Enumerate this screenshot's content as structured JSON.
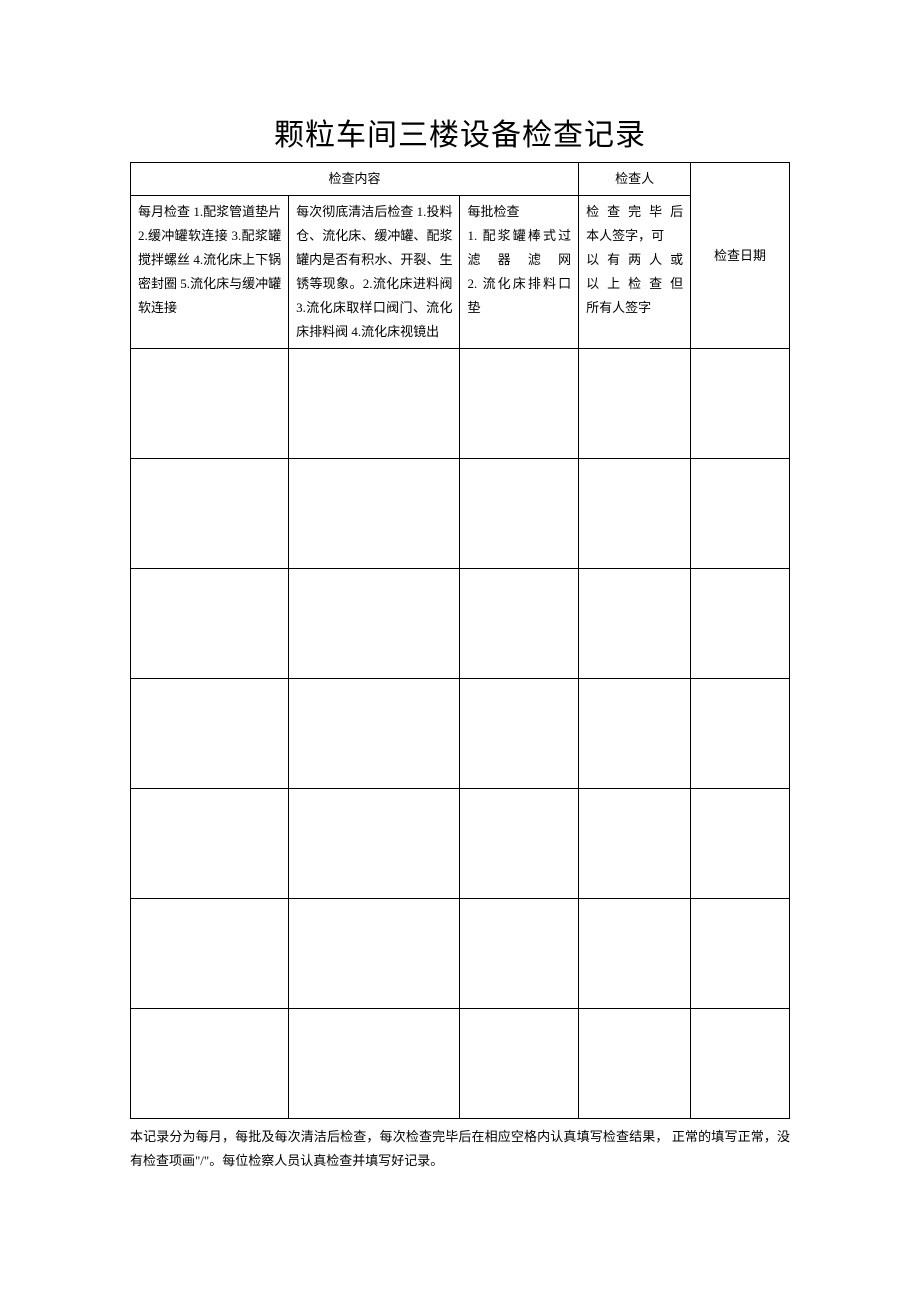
{
  "title": "颗粒车间三楼设备检查记录",
  "headers": {
    "inspection_content": "检查内容",
    "inspector": "检查人",
    "inspection_date": "检查日期"
  },
  "columns": {
    "monthly": "每月检查 1.配浆管道垫片 2.缓冲罐软连接 3.配浆罐搅拌螺丝 4.流化床上下锅密封圈 5.流化床与缓冲罐软连接",
    "after_clean": "每次彻底清洁后检查 1.投料仓、流化床、缓冲罐、配浆罐内是否有积水、开裂、生锈等现象。2.流化床进料阀 3.流化床取样口阀门、流化床排料阀 4.流化床视镜出",
    "per_batch_label": "每批检查",
    "per_batch_1": "1. 配浆罐棒式过滤器滤网",
    "per_batch_2": "2. 流化床排料口垫",
    "inspector_note_1": "检查完毕后",
    "inspector_note_2": "本人签字，可",
    "inspector_note_3": "以有两人或",
    "inspector_note_4": "以上检查但",
    "inspector_note_5": "所有人签字"
  },
  "blank_row_count": 7,
  "footer_note_1": "本记录分为每月，每批及每次清洁后检查，每次检查完毕后在相应空格内认真填写检查结果，",
  "footer_note_2": "正常的填写正常，没有检查项画\"/\"。每位检察人员认真检查并填写好记录。"
}
